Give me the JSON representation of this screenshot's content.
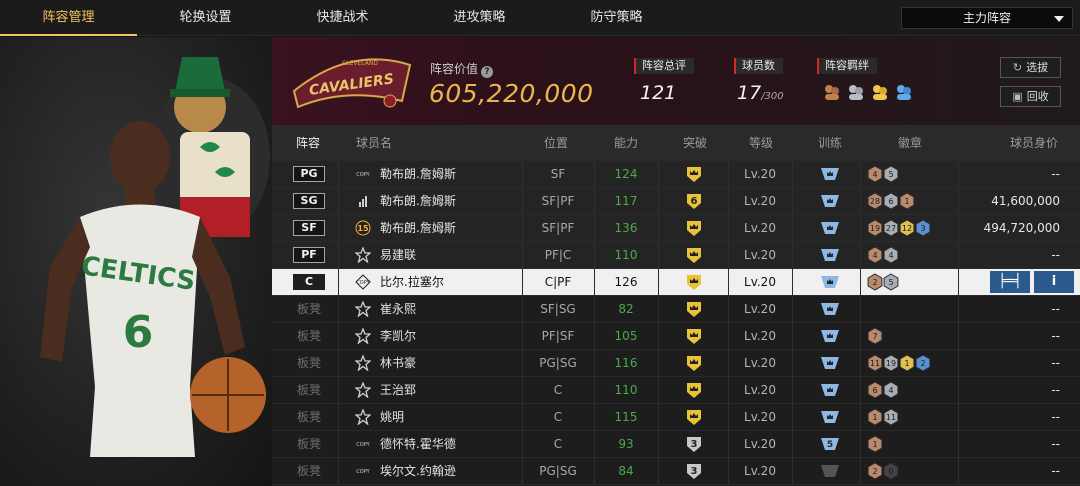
{
  "tabs": [
    {
      "label": "阵容管理",
      "active": true
    },
    {
      "label": "轮换设置",
      "active": false
    },
    {
      "label": "快捷战术",
      "active": false
    },
    {
      "label": "进攻策略",
      "active": false
    },
    {
      "label": "防守策略",
      "active": false
    }
  ],
  "lineup_select": {
    "value": "主力阵容"
  },
  "team": {
    "logo_text": "CAVALIERS",
    "logo_subtext": "CLEVELAND",
    "value_label": "阵容价值",
    "value": "605,220,000"
  },
  "stats": {
    "overall_label": "阵容总评",
    "overall_value": "121",
    "players_label": "球员数",
    "players_value": "17",
    "players_max": "/300",
    "bonds_label": "阵容羁绊"
  },
  "buttons": {
    "pick": "选拔",
    "recycle": "回收"
  },
  "player_art": {
    "jersey_text": "CELTICS",
    "jersey_number": "6"
  },
  "columns": [
    "阵容",
    "球员名",
    "位置",
    "能力",
    "突破",
    "等级",
    "训练",
    "徽章",
    "球员身价"
  ],
  "rows": [
    {
      "slot": "PG",
      "tag": "COPY",
      "name": "勒布朗.詹姆斯",
      "pos": "SF",
      "ovr": "124",
      "break": "",
      "lv": "Lv.20",
      "train": "",
      "badges": [
        "4",
        "5"
      ],
      "price": "--"
    },
    {
      "slot": "SG",
      "tag": "bars",
      "name": "勒布朗.詹姆斯",
      "pos": "SF|PF",
      "ovr": "117",
      "break": "6",
      "lv": "Lv.20",
      "train": "",
      "badges": [
        "28",
        "6",
        "1"
      ],
      "price": "41,600,000"
    },
    {
      "slot": "SF",
      "tag": "15",
      "name": "勒布朗.詹姆斯",
      "pos": "SF|PF",
      "ovr": "136",
      "break": "",
      "lv": "Lv.20",
      "train": "",
      "badges": [
        "19",
        "27",
        "12",
        "3"
      ],
      "price": "494,720,000"
    },
    {
      "slot": "PF",
      "tag": "star",
      "name": "易建联",
      "pos": "PF|C",
      "ovr": "110",
      "break": "",
      "lv": "Lv.20",
      "train": "",
      "badges": [
        "4",
        "4"
      ],
      "price": "--"
    },
    {
      "slot": "C",
      "tag": "COPY",
      "name": "比尔.拉塞尔",
      "pos": "C|PF",
      "ovr": "126",
      "break": "",
      "lv": "Lv.20",
      "train": "",
      "badges": [
        "2",
        "5"
      ],
      "price": "",
      "selected": true
    },
    {
      "slot": "板凳",
      "tag": "star",
      "name": "崔永熙",
      "pos": "SF|SG",
      "ovr": "82",
      "break": "",
      "lv": "Lv.20",
      "train": "",
      "badges": [],
      "price": "--"
    },
    {
      "slot": "板凳",
      "tag": "star",
      "name": "李凯尔",
      "pos": "PF|SF",
      "ovr": "105",
      "break": "",
      "lv": "Lv.20",
      "train": "",
      "badges": [
        "7"
      ],
      "price": "--"
    },
    {
      "slot": "板凳",
      "tag": "star",
      "name": "林书豪",
      "pos": "PG|SG",
      "ovr": "116",
      "break": "",
      "lv": "Lv.20",
      "train": "",
      "badges": [
        "11",
        "19",
        "1",
        "2"
      ],
      "price": "--"
    },
    {
      "slot": "板凳",
      "tag": "star",
      "name": "王治郅",
      "pos": "C",
      "ovr": "110",
      "break": "",
      "lv": "Lv.20",
      "train": "",
      "badges": [
        "6",
        "4"
      ],
      "price": "--"
    },
    {
      "slot": "板凳",
      "tag": "star",
      "name": "姚明",
      "pos": "C",
      "ovr": "115",
      "break": "",
      "lv": "Lv.20",
      "train": "",
      "badges": [
        "1",
        "11"
      ],
      "price": "--"
    },
    {
      "slot": "板凳",
      "tag": "COPY",
      "name": "德怀特.霍华德",
      "pos": "C",
      "ovr": "93",
      "break": "3",
      "lv": "Lv.20",
      "train": "5",
      "badges": [
        "1"
      ],
      "price": "--"
    },
    {
      "slot": "板凳",
      "tag": "COPY",
      "name": "埃尔文.约翰逊",
      "pos": "PG|SG",
      "ovr": "84",
      "break": "3",
      "lv": "Lv.20",
      "train": "",
      "badges": [
        "2",
        "0"
      ],
      "price": "--"
    }
  ],
  "colors": {
    "accent": "#f1c45a",
    "value_gold": "#e9b64e",
    "ovr_green": "#4caa4a",
    "action_blue": "#2b5a8f"
  }
}
